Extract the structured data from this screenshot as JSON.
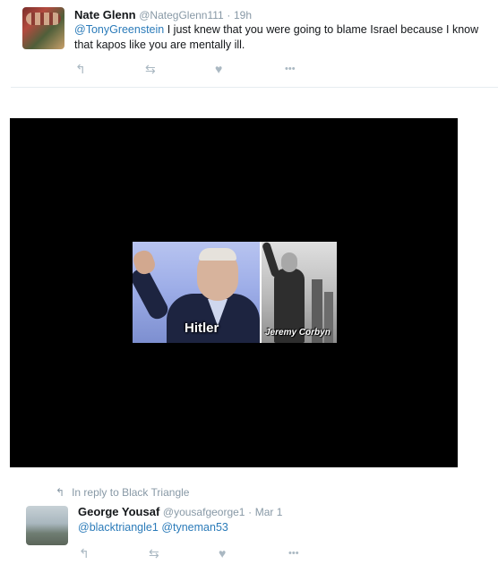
{
  "tweet1": {
    "name": "Nate Glenn",
    "handle": "@NategGlenn111",
    "separator": "·",
    "time": "19h",
    "mention": "@TonyGreenstein",
    "text": " I just knew that you were going to blame Israel  because I know that kapos like you are mentally ill."
  },
  "video": {
    "label_left": "Hitler",
    "label_right": "Jeremy Corbyn"
  },
  "reply_context": {
    "text": "In reply to Black Triangle"
  },
  "tweet2": {
    "name": "George Yousaf",
    "handle": "@yousafgeorge1",
    "separator": "·",
    "time": "Mar 1",
    "mention1": "@blacktriangle1",
    "mention2": "@tyneman53"
  },
  "actions": {
    "reply_icon": "↰",
    "retweet_icon": "⇆",
    "like_icon": "♥",
    "more_icon": "•••"
  },
  "colors": {
    "link": "#2b7bb9",
    "muted": "#8899a6",
    "action": "#aab8c2"
  },
  "icons": [
    "reply-icon",
    "retweet-icon",
    "like-icon",
    "more-icon"
  ]
}
